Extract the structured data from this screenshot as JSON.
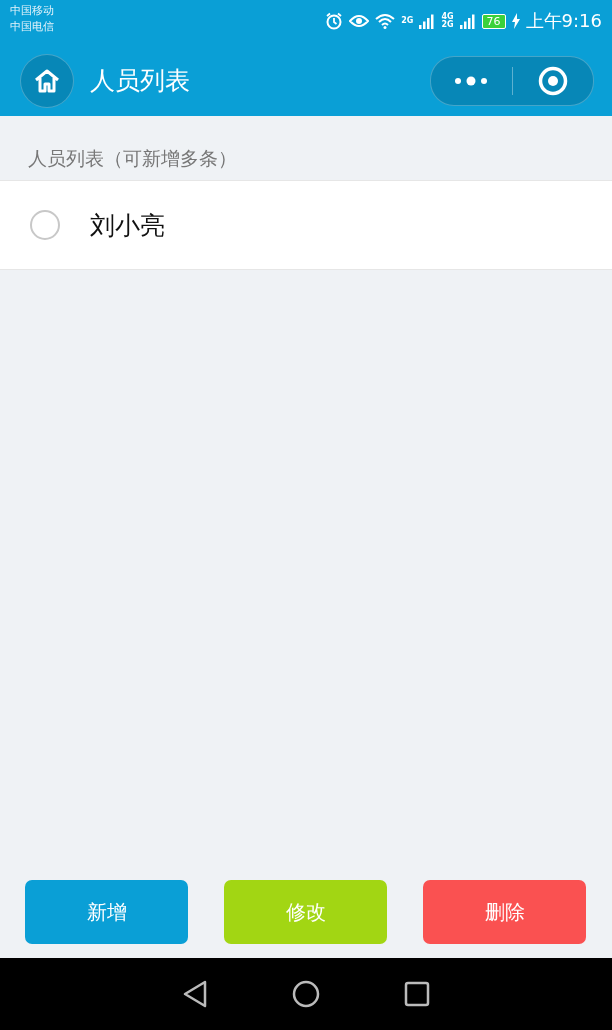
{
  "status_bar": {
    "carriers": [
      "中国移动",
      "中国电信"
    ],
    "network_labels": [
      "2G",
      "4G",
      "2G"
    ],
    "battery": {
      "text": "76",
      "charging": true
    },
    "time": "上午9:16"
  },
  "header": {
    "title": "人员列表"
  },
  "section": {
    "label": "人员列表（可新增多条）"
  },
  "people": [
    {
      "name": "刘小亮",
      "selected": false
    }
  ],
  "buttons": [
    {
      "label": "新增",
      "color": "#0a9fd6"
    },
    {
      "label": "修改",
      "color": "#a2d613"
    },
    {
      "label": "删除",
      "color": "#fa5151"
    }
  ]
}
